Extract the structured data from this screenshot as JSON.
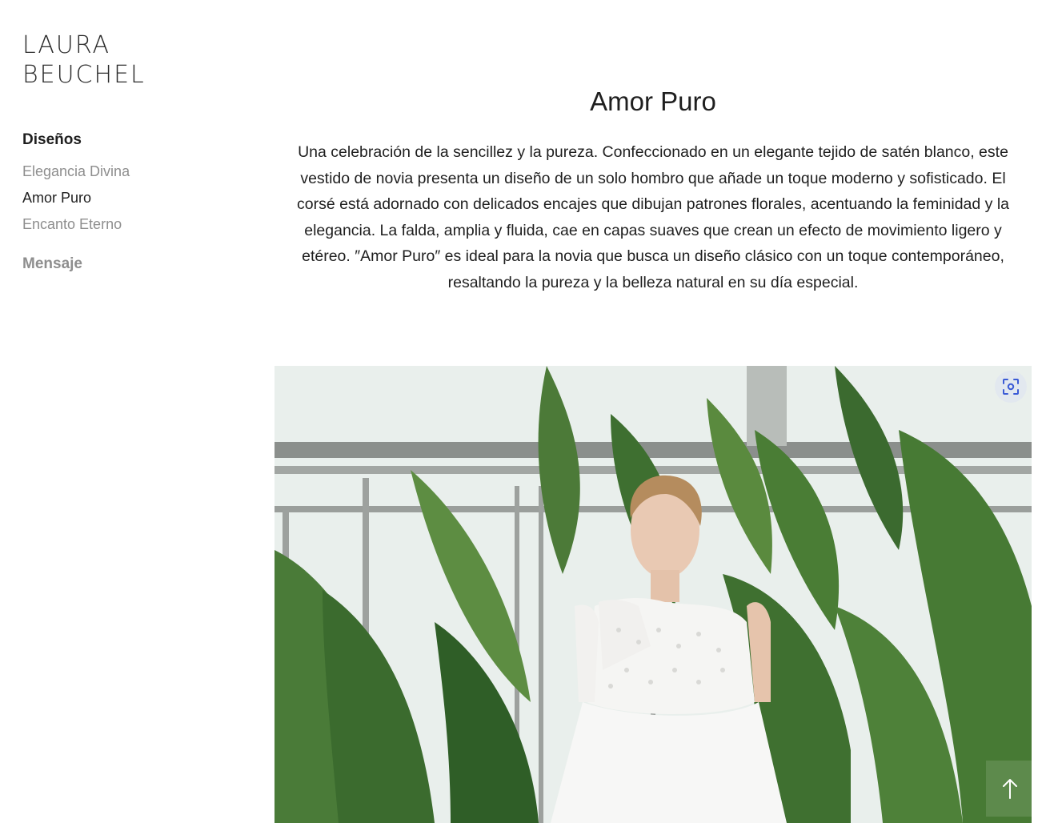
{
  "brand": {
    "line1": "LAURA",
    "line2": "BEUCHEL"
  },
  "nav": {
    "heading": "Diseños",
    "items": [
      {
        "label": "Elegancia Divina",
        "active": false
      },
      {
        "label": "Amor Puro",
        "active": true
      },
      {
        "label": "Encanto Eterno",
        "active": false
      }
    ],
    "section": "Mensaje"
  },
  "main": {
    "title": "Amor Puro",
    "description": "Una celebración de la sencillez y la pureza. Confeccionado en un elegante tejido de satén blanco, este vestido de novia presenta un diseño de un solo hombro que añade un toque moderno y sofisticado. El corsé está adornado con delicados encajes que dibujan patrones florales, acentuando la feminidad y la elegancia. La falda, amplia y fluida, cae en capas suaves que crean un efecto de movimiento ligero y etéreo. ″Amor Puro″ es ideal para la novia que busca un diseño clásico con un toque contemporáneo, resaltando la pureza y la belleza natural en su día especial."
  },
  "image": {
    "focus_icon": "focus-scan-icon"
  },
  "scroll_top_icon": "arrow-up-icon",
  "colors": {
    "text": "#1f1f1f",
    "muted": "#8e8e8e",
    "foliage": "#3f7a3a"
  }
}
